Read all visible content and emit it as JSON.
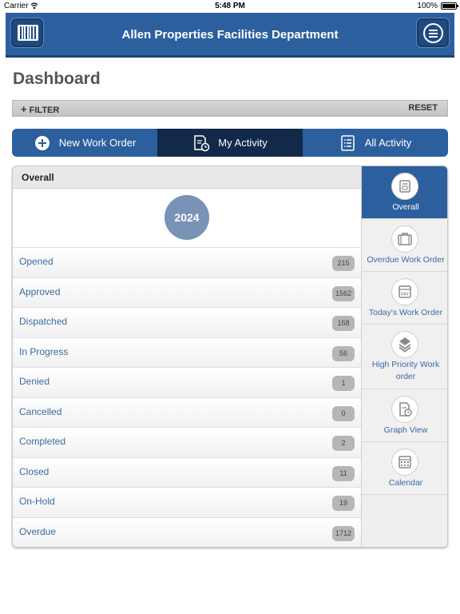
{
  "status_bar": {
    "carrier": "Carrier",
    "time": "5:48 PM",
    "battery": "100%"
  },
  "header": {
    "title": "Allen Properties Facilities Department",
    "left_icon": "barcode-icon",
    "right_icon": "hamburger-menu-icon"
  },
  "page": {
    "title": "Dashboard"
  },
  "filter_bar": {
    "filter_label": "FILTER",
    "reset_label": "RESET"
  },
  "tabs": [
    {
      "label": "New Work Order",
      "icon": "add-circle-icon",
      "active": false
    },
    {
      "label": "My Activity",
      "icon": "document-clock-icon",
      "active": true
    },
    {
      "label": "All Activity",
      "icon": "list-icon",
      "active": false
    }
  ],
  "overall": {
    "heading": "Overall",
    "year": "2024",
    "statuses": [
      {
        "label": "Opened",
        "count": "215"
      },
      {
        "label": "Approved",
        "count": "1562"
      },
      {
        "label": "Dispatched",
        "count": "158"
      },
      {
        "label": "In Progress",
        "count": "56"
      },
      {
        "label": "Denied",
        "count": "1"
      },
      {
        "label": "Cancelled",
        "count": "0"
      },
      {
        "label": "Completed",
        "count": "2"
      },
      {
        "label": "Closed",
        "count": "11"
      },
      {
        "label": "On-Hold",
        "count": "19"
      },
      {
        "label": "Overdue",
        "count": "1712"
      }
    ]
  },
  "side_nav": [
    {
      "label": "Overall",
      "icon": "overall-icon",
      "active": true
    },
    {
      "label": "Overdue Work Order",
      "icon": "briefcase-icon",
      "active": false
    },
    {
      "label": "Today's Work Order",
      "icon": "calendar-day-icon",
      "active": false
    },
    {
      "label": "High Priority Work order",
      "icon": "layers-icon",
      "active": false
    },
    {
      "label": "Graph View",
      "icon": "graph-document-icon",
      "active": false
    },
    {
      "label": "Calendar",
      "icon": "calendar-icon",
      "active": false
    }
  ],
  "colors": {
    "primary": "#2c5f9e",
    "active_tab": "#12294a",
    "year_circle": "#7993b7",
    "link_text": "#3a6aa3"
  }
}
